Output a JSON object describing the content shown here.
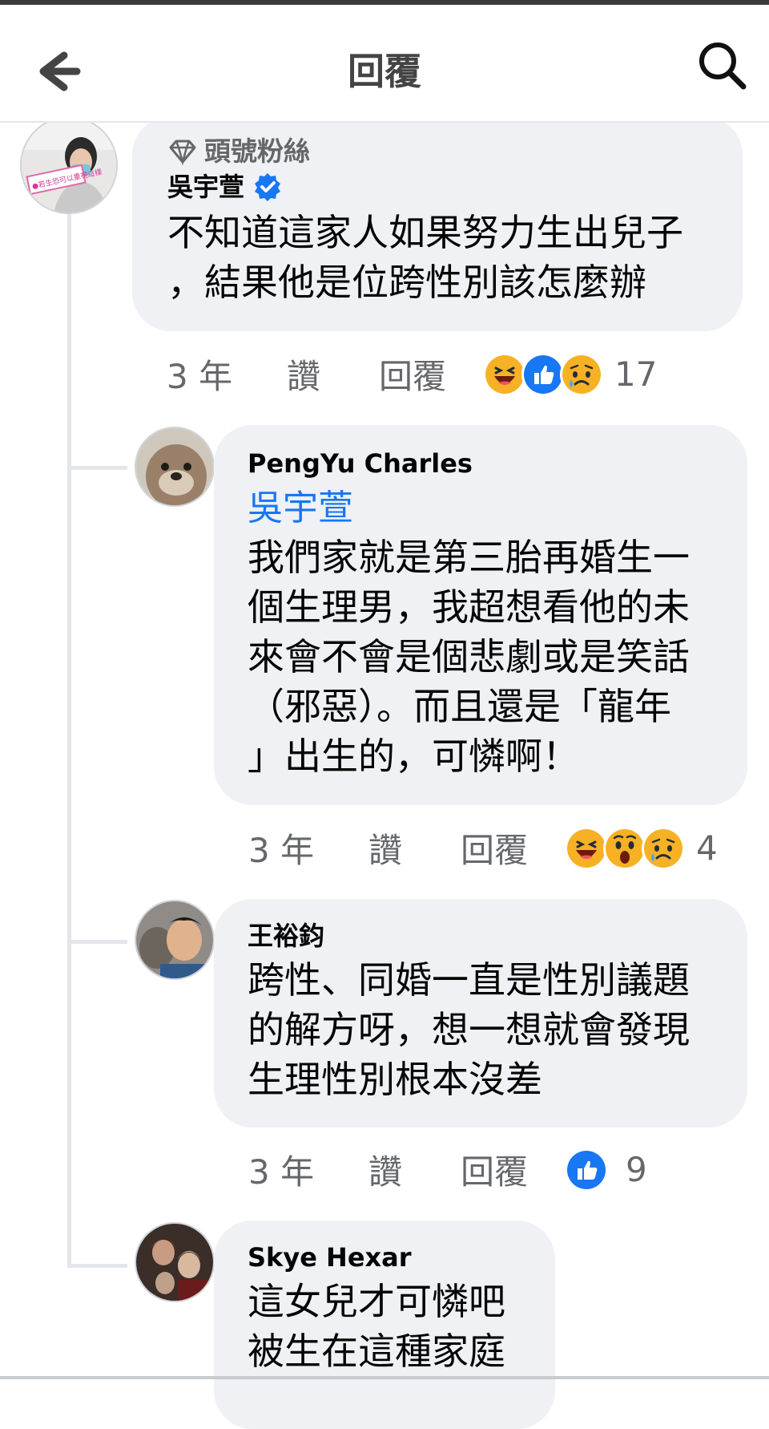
{
  "header": {
    "title": "回覆"
  },
  "comments": [
    {
      "badge": "頭號粉絲",
      "author": "吳宇萱",
      "verified": true,
      "text": [
        "不知道這家人如果努力生出兒子",
        "，結果他是位跨性別該怎麼辦"
      ],
      "time": "3 年",
      "like": "讚",
      "reply": "回覆",
      "reactions": [
        "haha",
        "like",
        "sad"
      ],
      "reaction_count": "17",
      "avatar_text": "●若生恐可以重視這樣"
    },
    {
      "author": "PengYu Charles",
      "mention": "吳宇萱",
      "text": [
        "我們家就是第三胎再婚生一",
        "個生理男，我超想看他的未",
        "來會不會是個悲劇或是笑話",
        "（邪惡）。而且還是「龍年",
        "」出生的，可憐啊！"
      ],
      "time": "3 年",
      "like": "讚",
      "reply": "回覆",
      "reactions": [
        "haha",
        "wow",
        "sad"
      ],
      "reaction_count": "4"
    },
    {
      "author": "王裕鈞",
      "text": [
        "跨性、同婚一直是性別議題",
        "的解方呀，想一想就會發現",
        "生理性別根本沒差"
      ],
      "time": "3 年",
      "like": "讚",
      "reply": "回覆",
      "reactions": [
        "like"
      ],
      "reaction_count": "9"
    },
    {
      "author": "Skye Hexar",
      "text": [
        "這女兒才可憐吧",
        "被生在這種家庭"
      ]
    }
  ],
  "colors": {
    "like_blue": "#1877f2",
    "haha_yellow": "#f7b125",
    "bubble_bg": "#eff1f4"
  }
}
